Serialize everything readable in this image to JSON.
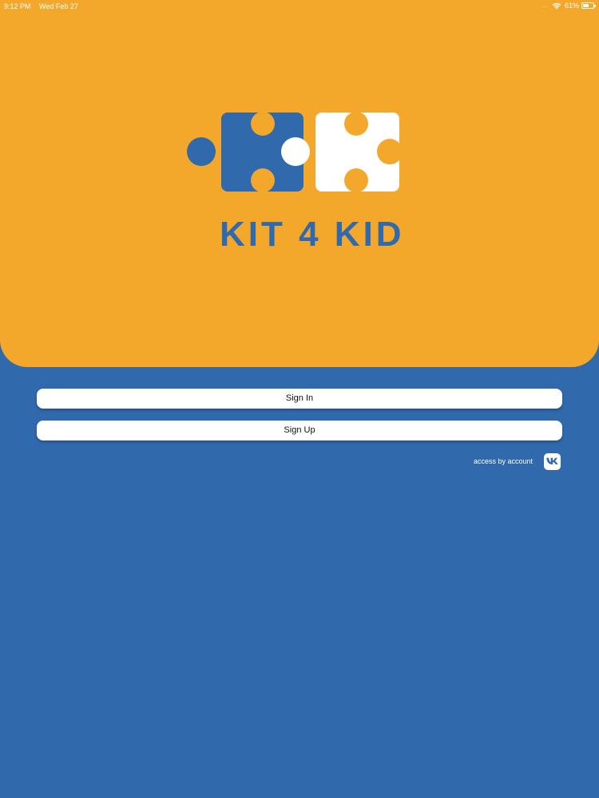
{
  "status_bar": {
    "time": "9:12 PM",
    "date": "Wed Feb 27",
    "signal": "....",
    "battery_percent": "61%",
    "battery_level": 0.61
  },
  "logo": {
    "text": "KIT 4 KID",
    "icon": "puzzle-pieces-icon"
  },
  "auth": {
    "sign_in_label": "Sign In",
    "sign_up_label": "Sign Up",
    "access_label": "access by account",
    "vk_icon": "vk-icon"
  },
  "colors": {
    "hero_background": "#f3a82b",
    "page_background": "#3169ad",
    "brand_blue": "#3169ad",
    "button_background": "#ffffff"
  }
}
